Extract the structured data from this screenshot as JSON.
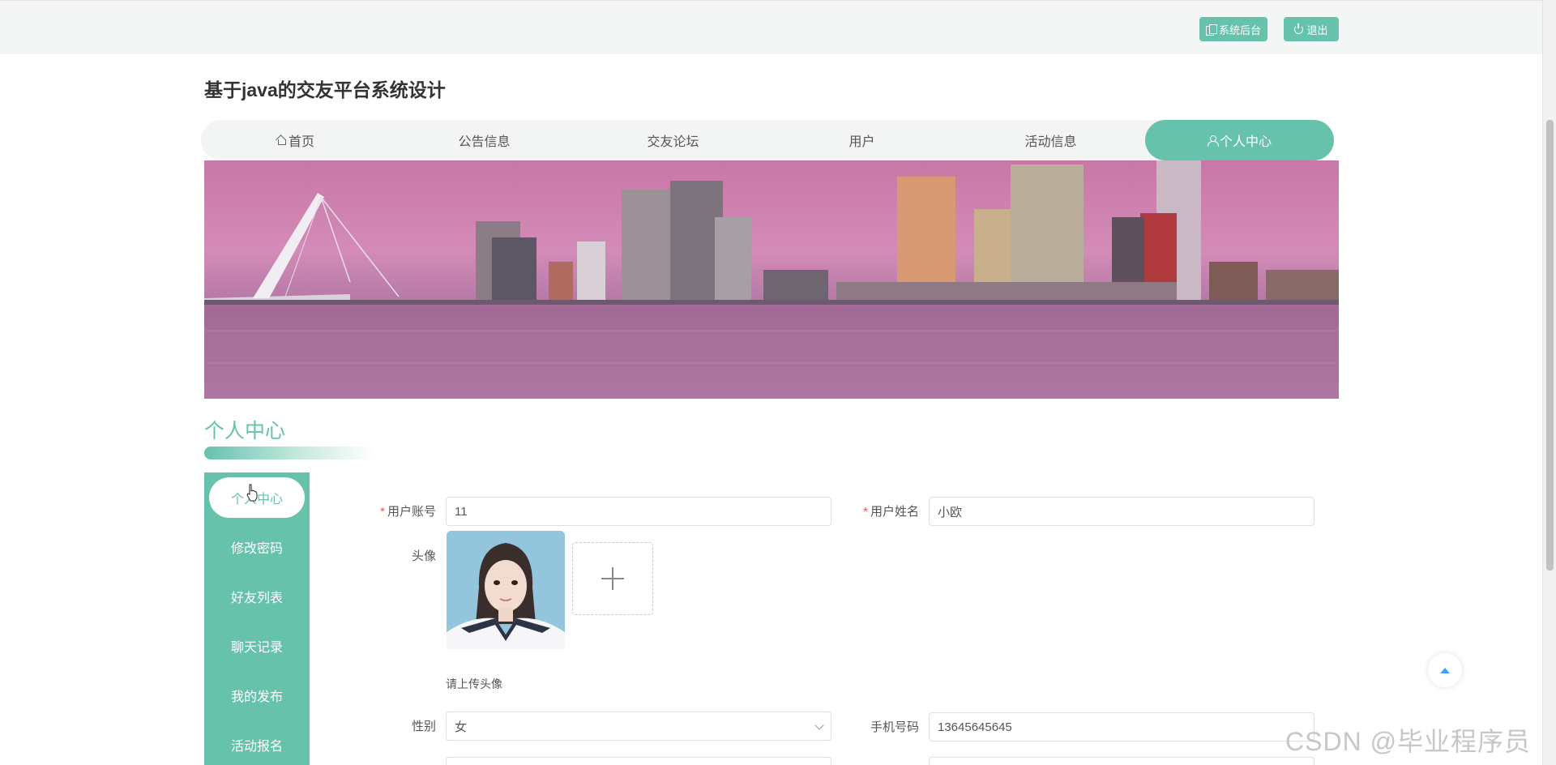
{
  "topbar": {
    "admin_label": "系统后台",
    "logout_label": "退出"
  },
  "site": {
    "title": "基于java的交友平台系统设计"
  },
  "nav": {
    "items": [
      {
        "label": "首页"
      },
      {
        "label": "公告信息"
      },
      {
        "label": "交友论坛"
      },
      {
        "label": "用户"
      },
      {
        "label": "活动信息"
      },
      {
        "label": "个人中心"
      }
    ]
  },
  "section": {
    "title": "个人中心"
  },
  "side_menu": {
    "items": [
      {
        "label": "个人中心"
      },
      {
        "label": "修改密码"
      },
      {
        "label": "好友列表"
      },
      {
        "label": "聊天记录"
      },
      {
        "label": "我的发布"
      },
      {
        "label": "活动报名"
      }
    ]
  },
  "form": {
    "account_label": "用户账号",
    "account_value": "11",
    "name_label": "用户姓名",
    "name_value": "小欧",
    "avatar_label": "头像",
    "avatar_hint": "请上传头像",
    "gender_label": "性别",
    "gender_value": "女",
    "phone_label": "手机号码",
    "phone_value": "13645645645"
  },
  "watermark": "CSDN @毕业程序员",
  "colors": {
    "accent": "#66c2ab",
    "required": "#e55555"
  }
}
